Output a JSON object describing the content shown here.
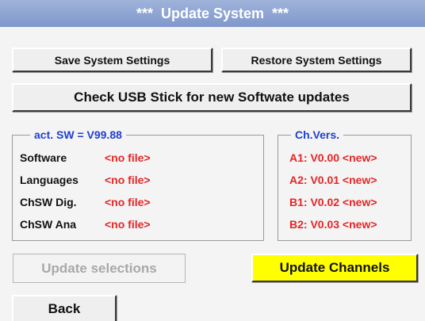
{
  "title": "***  Update System  ***",
  "buttons": {
    "save": "Save System Settings",
    "restore": "Restore System Settings",
    "check_usb": "Check USB Stick for new Softwate updates",
    "update_selections": "Update selections",
    "update_channels": "Update Channels",
    "back": "Back"
  },
  "software_group": {
    "legend": "act. SW = V99.88",
    "rows": [
      {
        "label": "Software",
        "value": "<no file>"
      },
      {
        "label": "Languages",
        "value": "<no file>"
      },
      {
        "label": "ChSW Dig.",
        "value": "<no file>"
      },
      {
        "label": "ChSW Ana",
        "value": "<no file>"
      }
    ]
  },
  "channel_group": {
    "legend": "Ch.Vers.",
    "rows": [
      "A1: V0.00 <new>",
      "A2: V0.01 <new>",
      "B1: V0.02 <new>",
      "B2: V0.03 <new>"
    ]
  },
  "colors": {
    "title_bar": "#8ea4d3",
    "legend_text": "#1f3fd0",
    "status_text": "#e52626",
    "highlight_button": "#ffff00",
    "disabled_text": "#a8a8a8"
  }
}
